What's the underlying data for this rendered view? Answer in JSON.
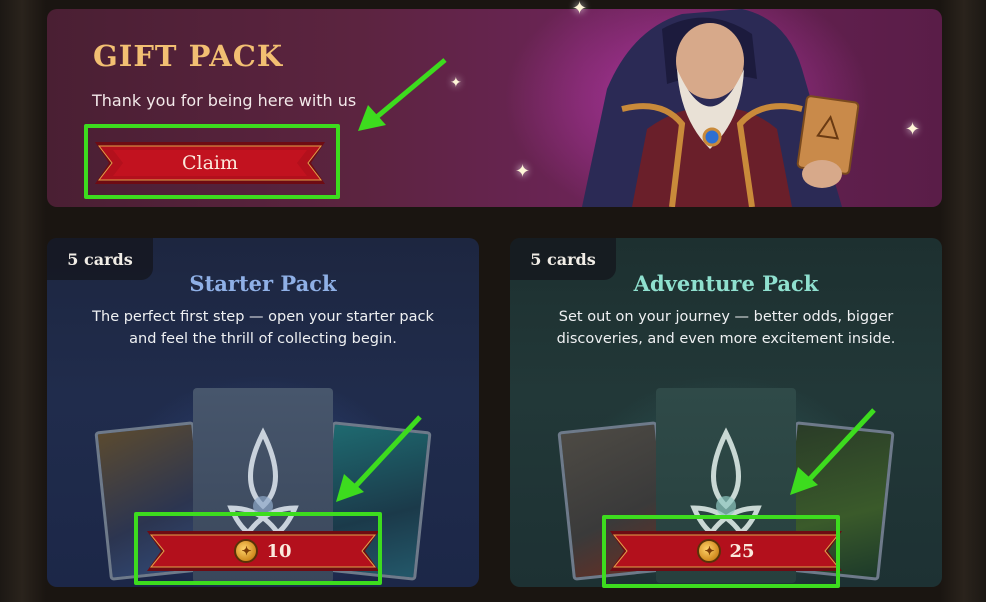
{
  "gift": {
    "title": "GIFT PACK",
    "subtitle": "Thank you for being here with us",
    "claim_label": "Claim"
  },
  "packs": [
    {
      "count": "5 cards",
      "title": "Starter Pack",
      "description": "The perfect first step — open your starter pack and feel the thrill of collecting begin.",
      "price": "10",
      "currency_icon": "coin-icon"
    },
    {
      "count": "5 cards",
      "title": "Adventure Pack",
      "description": "Set out on your journey — better odds, bigger discoveries, and even more excitement inside.",
      "price": "25",
      "currency_icon": "coin-icon"
    }
  ],
  "colors": {
    "highlight": "#3ddc1e",
    "button_red": "#b3101c",
    "gift_title": "#f2bf72",
    "starter_title": "#8fb0e6",
    "adventure_title": "#8fe0cf"
  }
}
